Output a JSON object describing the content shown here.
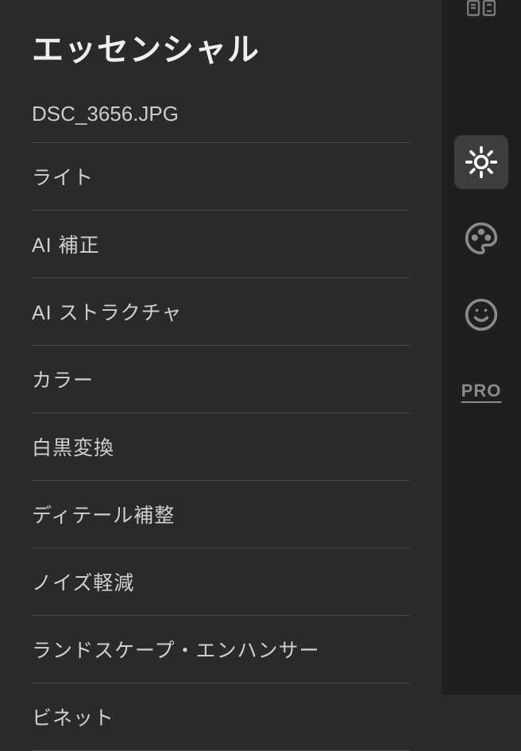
{
  "panel": {
    "title": "エッセンシャル",
    "filename": "DSC_3656.JPG"
  },
  "tools": [
    {
      "label": "ライト"
    },
    {
      "label": "AI 補正"
    },
    {
      "label": "AI ストラクチャ"
    },
    {
      "label": "カラー"
    },
    {
      "label": "白黒変換"
    },
    {
      "label": "ディテール補整"
    },
    {
      "label": "ノイズ軽減"
    },
    {
      "label": "ランドスケープ・エンハンサー"
    },
    {
      "label": "ビネット"
    }
  ],
  "sidebar": {
    "pro_label": "PRO"
  }
}
